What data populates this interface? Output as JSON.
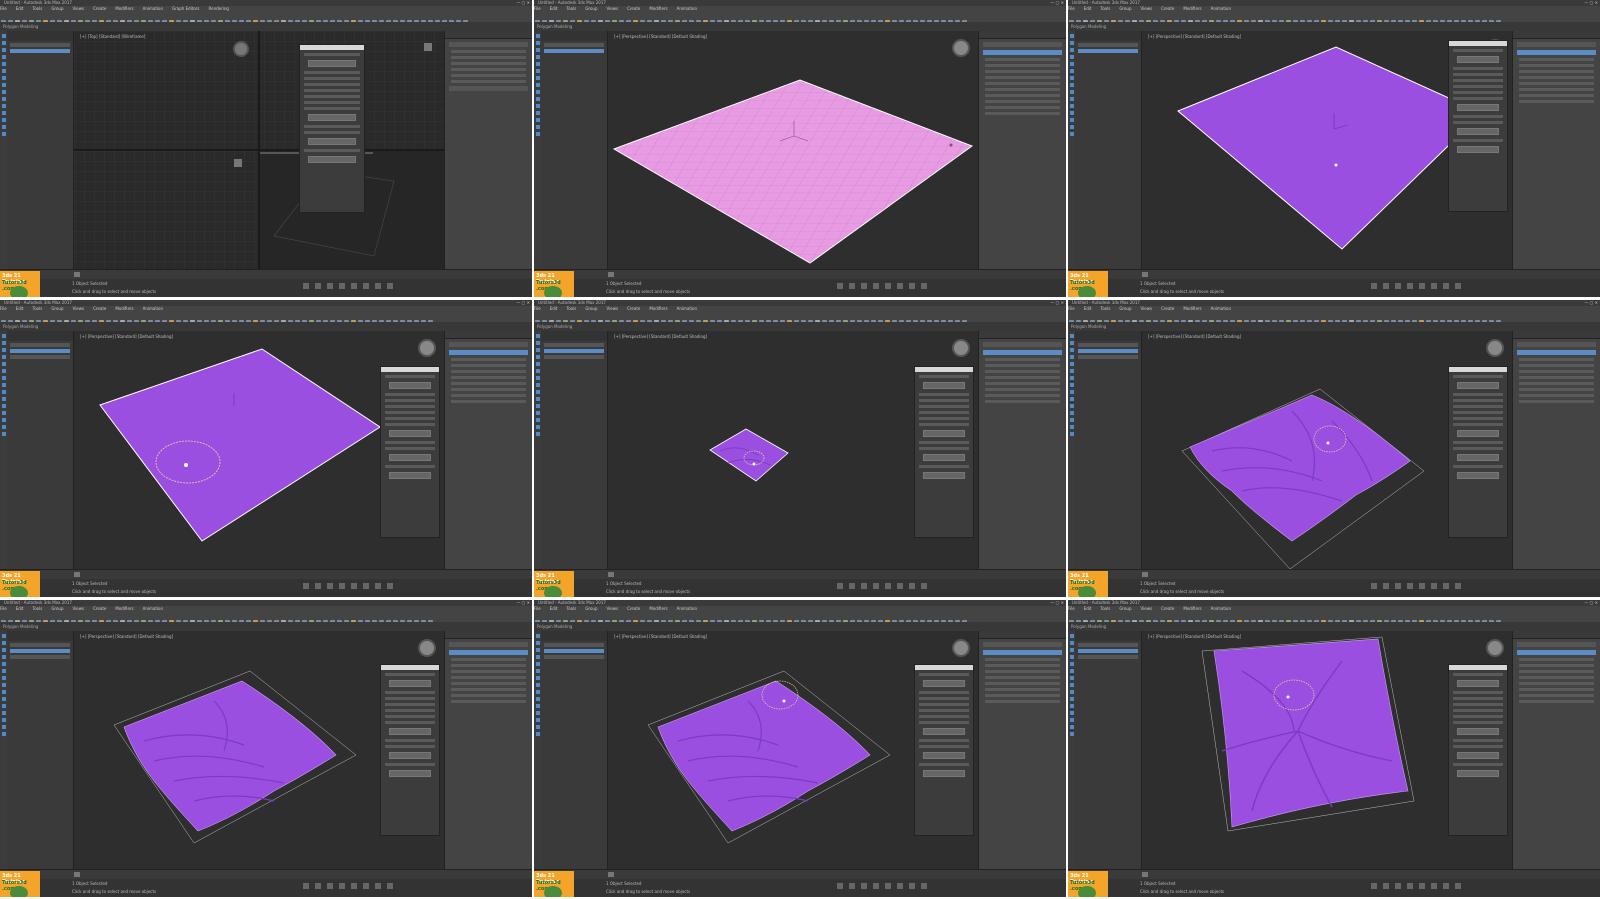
{
  "app": {
    "title": "Untitled - Autodesk 3ds Max 2017",
    "menu": [
      "File",
      "Edit",
      "Tools",
      "Group",
      "Views",
      "Create",
      "Modifiers",
      "Animation",
      "Graph Editors",
      "Rendering",
      "Civil View",
      "Customize",
      "Scripting",
      "Help"
    ],
    "ribbon_label": "Polygon Modeling",
    "workspace": "Workspaces: Default",
    "status_line1": "1 Object Selected",
    "status_line2": "Click and drag to select and move objects",
    "frame_label": "0 / 100",
    "logo_line1": "3ds 21 Training",
    "logo_line2": "Tutors3d .com"
  },
  "panels": [
    {
      "view_label": "[+] [Top] [Standard] [Wireframe]",
      "state": "Plane created (quad view)",
      "object_color": "#d9d9d9"
    },
    {
      "view_label": "[+] [Perspective] [Standard] [Default Shading]",
      "state": "Pink plane",
      "object_color": "#e79be2"
    },
    {
      "view_label": "[+] [Perspective] [Standard] [Default Shading]",
      "state": "Purple plane",
      "object_color": "#9a4fe0"
    },
    {
      "view_label": "[+] [Perspective] [Standard] [Default Shading]",
      "state": "Brush cursor on plane",
      "object_color": "#9a4fe0"
    },
    {
      "view_label": "[+] [Perspective] [Standard] [Default Shading]",
      "state": "Zoomed out cloth",
      "object_color": "#9a4fe0"
    },
    {
      "view_label": "[+] [Perspective] [Standard] [Default Shading]",
      "state": "Wrinkled cloth",
      "object_color": "#9a4fe0"
    },
    {
      "view_label": "[+] [Perspective] [Standard] [Default Shading]",
      "state": "Draped cloth",
      "object_color": "#9a4fe0"
    },
    {
      "view_label": "[+] [Perspective] [Standard] [Default Shading]",
      "state": "Draped cloth with brush",
      "object_color": "#9a4fe0"
    },
    {
      "view_label": "[+] [Perspective] [Standard] [Default Shading]",
      "state": "Cloth pulled",
      "object_color": "#9a4fe0"
    }
  ]
}
